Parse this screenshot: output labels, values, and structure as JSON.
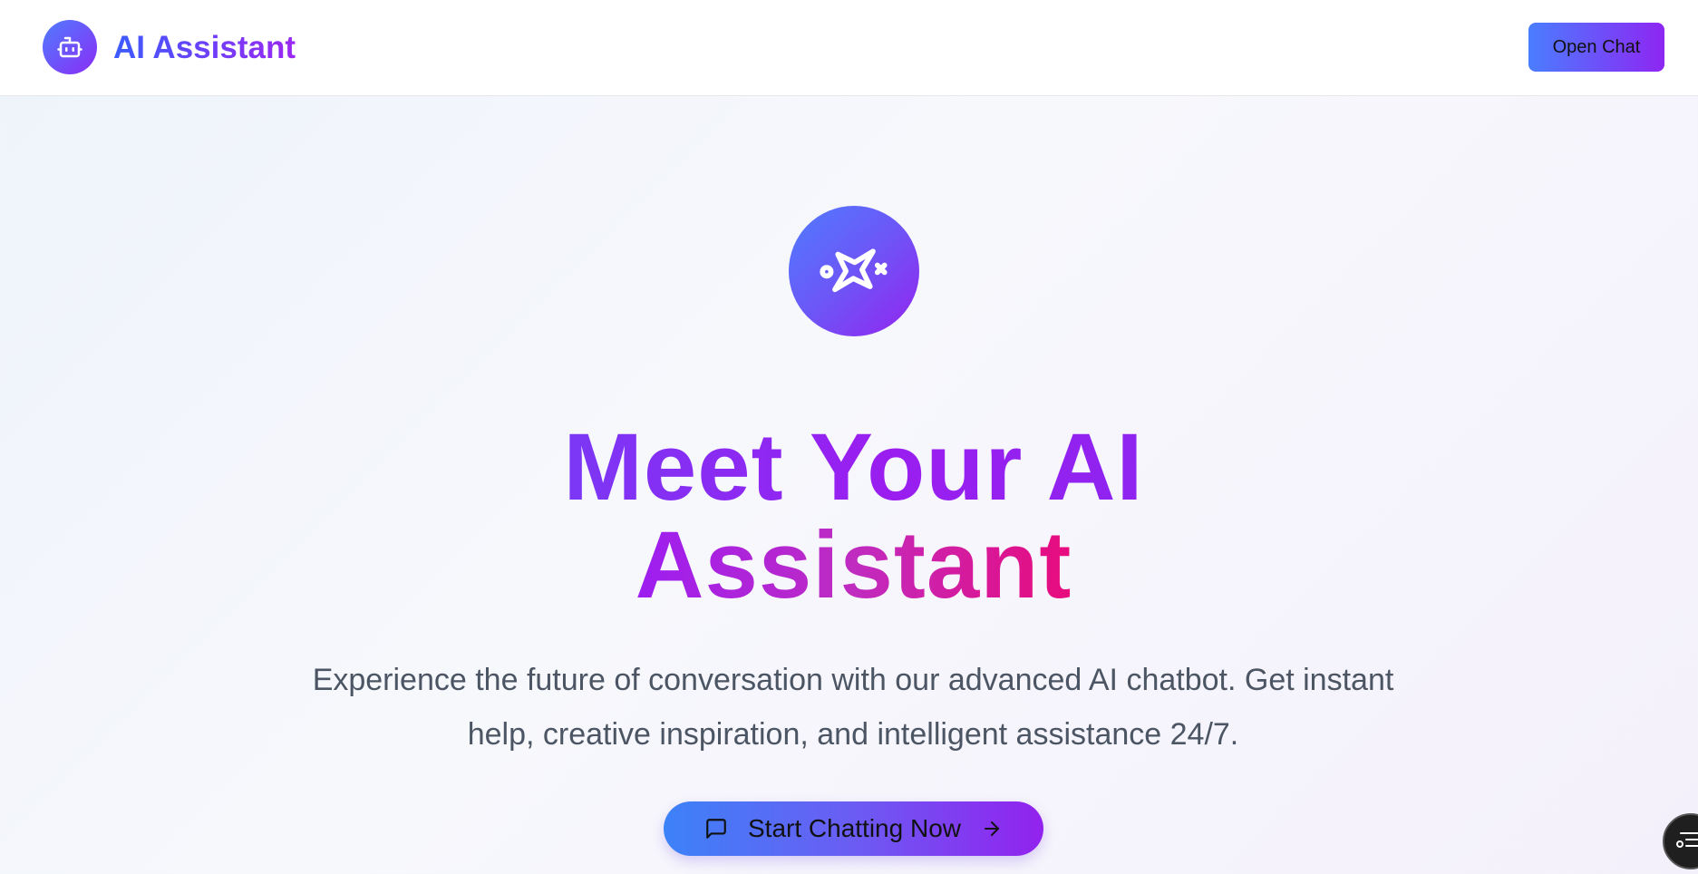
{
  "header": {
    "brand_title": "AI Assistant",
    "brand_icon": "robot-icon",
    "open_chat_label": "Open Chat"
  },
  "hero": {
    "icon": "sparkles-icon",
    "headline_line1": "Meet Your AI",
    "headline_line2": "Assistant",
    "subtitle": "Experience the future of conversation with our advanced AI chatbot. Get instant help, creative inspiration, and intelligent assistance 24/7.",
    "cta_label": "Start Chatting Now",
    "cta_icon_left": "message-square-icon",
    "cta_icon_right": "arrow-right-icon"
  },
  "floating": {
    "icon": "settings-list-icon"
  },
  "colors": {
    "gradient_start": "#3b82f6",
    "gradient_end": "#9333ea",
    "headline_pink": "#ec0a7a",
    "text_muted": "#4b5563"
  }
}
